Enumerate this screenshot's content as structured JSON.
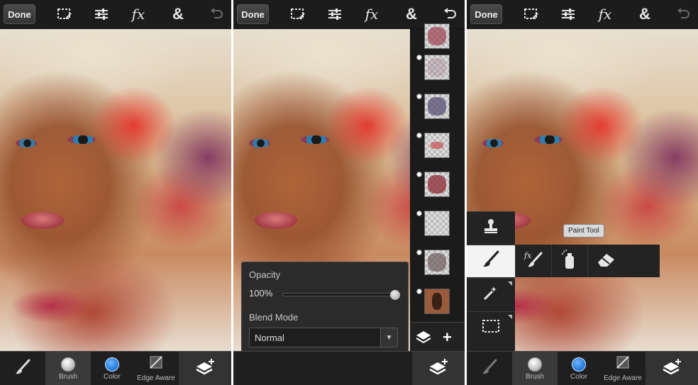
{
  "panels": [
    {
      "topbar": {
        "done_label": "Done"
      },
      "bottombar": {
        "brush_label": "Brush",
        "color_label": "Color",
        "edge_label": "Edge Aware"
      }
    },
    {
      "topbar": {
        "done_label": "Done"
      },
      "opacity_popup": {
        "opacity_label": "Opacity",
        "opacity_value": "100%",
        "opacity_level": 1.0,
        "blend_label": "Blend Mode",
        "blend_value": "Normal"
      },
      "layers": {
        "count": 8
      }
    },
    {
      "topbar": {
        "done_label": "Done"
      },
      "tooltip": "Paint Tool",
      "bottombar": {
        "brush_label": "Brush",
        "color_label": "Color",
        "edge_label": "Edge Aware"
      }
    }
  ],
  "colors": {
    "color_swatch": "#1e78d8",
    "bar": "#1c1c1c"
  },
  "icons": [
    "selection-icon",
    "adjustments-icon",
    "fx-icon",
    "ampersand-icon",
    "undo-icon",
    "brush-icon",
    "layers-add-icon",
    "stamp-icon",
    "magic-wand-icon",
    "marquee-icon",
    "fx-brush-icon",
    "spray-icon",
    "eraser-icon"
  ]
}
